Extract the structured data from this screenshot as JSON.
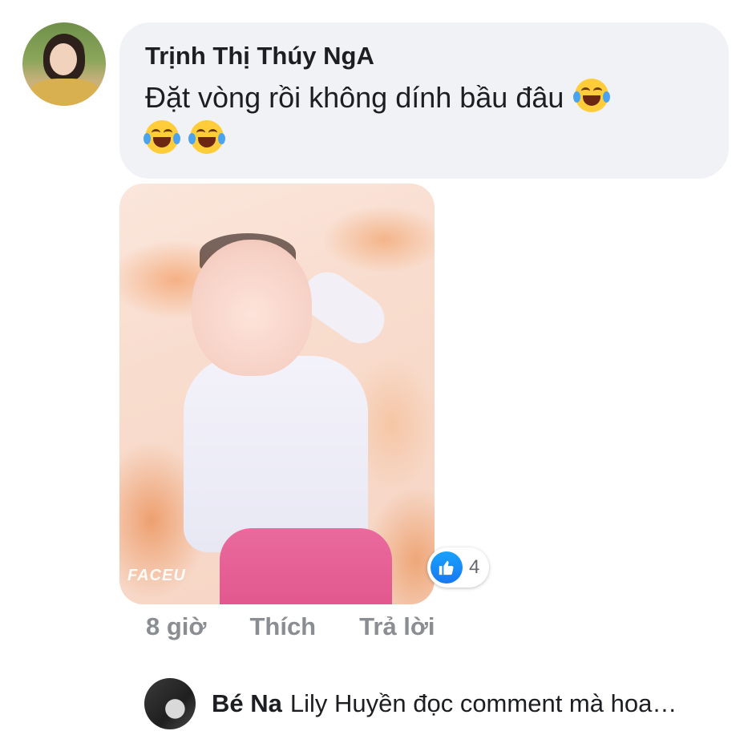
{
  "comment": {
    "author": "Trịnh Thị Thúy NgA",
    "text": "Đặt vòng rồi không dính bầu đâu",
    "emojis": [
      "laughing-tears-emoji",
      "laughing-tears-emoji",
      "laughing-tears-emoji"
    ],
    "photo_watermark": "FACEU",
    "reaction_count": "4",
    "time": "8 giờ",
    "like_label": "Thích",
    "reply_label": "Trả lời"
  },
  "reply_preview": {
    "author": "Bé Na",
    "text": "Lily Huyền đọc comment mà hoa…"
  },
  "colors": {
    "bubble": "#f0f2f5",
    "like_blue": "#1877f2",
    "muted_text": "#8a8d91"
  }
}
